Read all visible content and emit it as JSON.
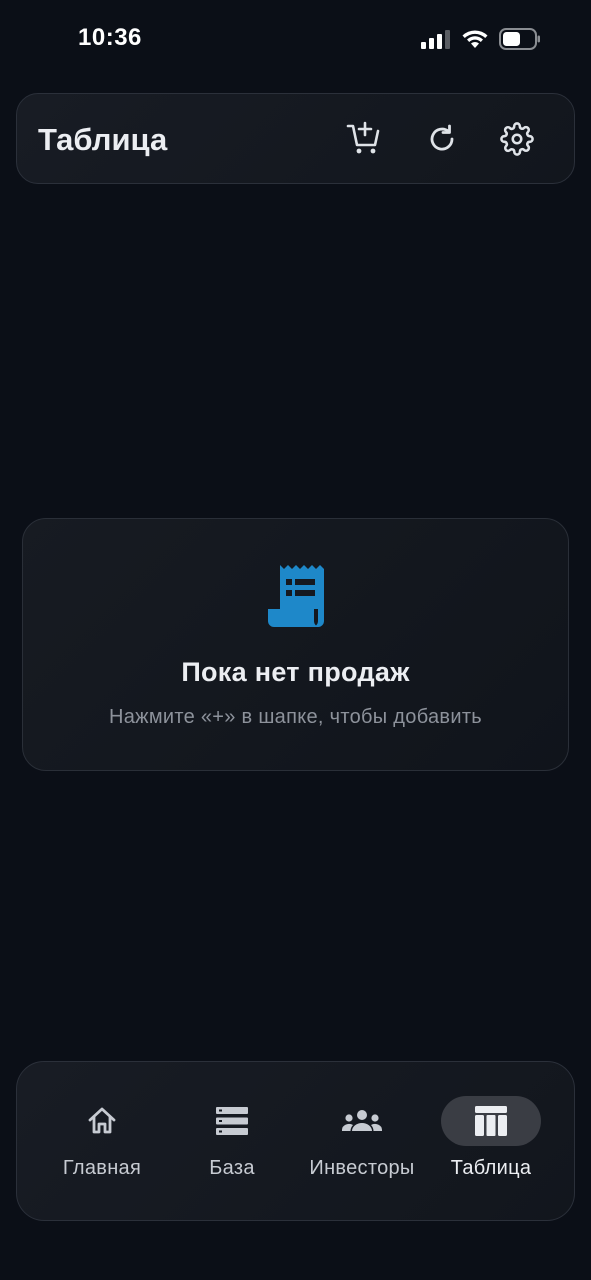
{
  "status_bar": {
    "time": "10:36"
  },
  "header": {
    "title": "Таблица",
    "icons": [
      "add-to-cart-icon",
      "refresh-icon",
      "gear-icon"
    ]
  },
  "empty_state": {
    "icon": "receipt-icon",
    "title": "Пока нет продаж",
    "subtitle": "Нажмите «+» в шапке, чтобы добавить",
    "icon_color": "#1e88c9"
  },
  "bottom_nav": {
    "items": [
      {
        "label": "Главная",
        "icon": "home-icon",
        "active": false
      },
      {
        "label": "База",
        "icon": "database-icon",
        "active": false
      },
      {
        "label": "Инвесторы",
        "icon": "group-icon",
        "active": false
      },
      {
        "label": "Таблица",
        "icon": "table-icon",
        "active": true
      }
    ]
  },
  "colors": {
    "background": "#0b0f17",
    "card": "#151920",
    "accent": "#1e88c9",
    "active_pill": "#3a3d44"
  }
}
